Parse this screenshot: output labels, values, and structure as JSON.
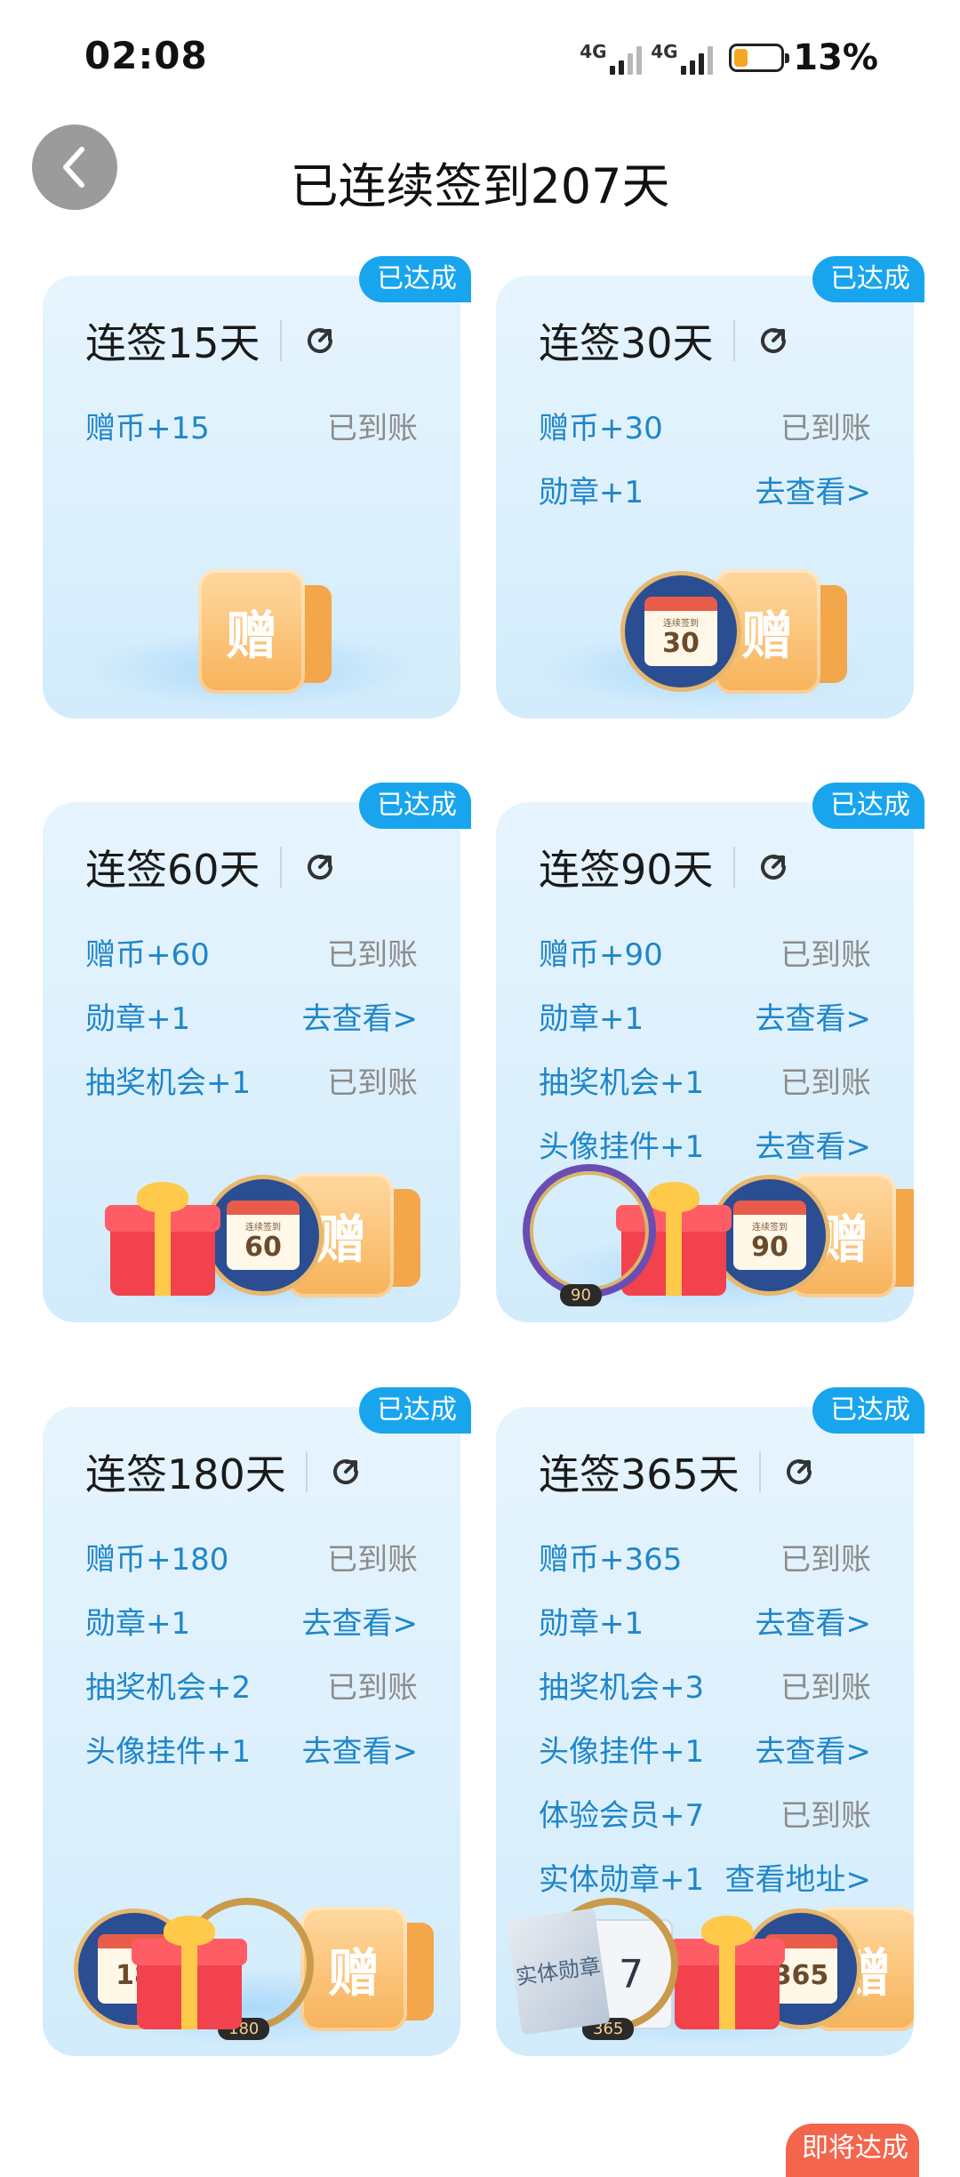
{
  "status_bar": {
    "time": "02:08",
    "signal1_label": "4G",
    "signal2_label": "4G",
    "battery_percent": "13%",
    "battery_level": 0.13
  },
  "header": {
    "title": "已连续签到207天"
  },
  "cards": [
    {
      "badge": "已达成",
      "title": "连签15天",
      "rows": [
        {
          "name": "赠币+15",
          "status": "已到账",
          "link": false
        }
      ]
    },
    {
      "badge": "已达成",
      "title": "连签30天",
      "rows": [
        {
          "name": "赠币+30",
          "status": "已到账",
          "link": false
        },
        {
          "name": "勋章+1",
          "status": "去查看>",
          "link": true
        }
      ],
      "medal_text": "连续签到",
      "medal_number": "30"
    },
    {
      "badge": "已达成",
      "title": "连签60天",
      "rows": [
        {
          "name": "赠币+60",
          "status": "已到账",
          "link": false
        },
        {
          "name": "勋章+1",
          "status": "去查看>",
          "link": true
        },
        {
          "name": "抽奖机会+1",
          "status": "已到账",
          "link": false
        }
      ],
      "medal_text": "连续签到",
      "medal_number": "60"
    },
    {
      "badge": "已达成",
      "title": "连签90天",
      "rows": [
        {
          "name": "赠币+90",
          "status": "已到账",
          "link": false
        },
        {
          "name": "勋章+1",
          "status": "去查看>",
          "link": true
        },
        {
          "name": "抽奖机会+1",
          "status": "已到账",
          "link": false
        },
        {
          "name": "头像挂件+1",
          "status": "去查看>",
          "link": true
        }
      ],
      "medal_text": "连续签到",
      "medal_number": "90",
      "ring_tag": "90"
    },
    {
      "badge": "已达成",
      "title": "连签180天",
      "rows": [
        {
          "name": "赠币+180",
          "status": "已到账",
          "link": false
        },
        {
          "name": "勋章+1",
          "status": "去查看>",
          "link": true
        },
        {
          "name": "抽奖机会+2",
          "status": "已到账",
          "link": false
        },
        {
          "name": "头像挂件+1",
          "status": "去查看>",
          "link": true
        }
      ],
      "medal_number": "18",
      "ring_tag": "180"
    },
    {
      "badge": "已达成",
      "title": "连签365天",
      "rows": [
        {
          "name": "赠币+365",
          "status": "已到账",
          "link": false
        },
        {
          "name": "勋章+1",
          "status": "去查看>",
          "link": true
        },
        {
          "name": "抽奖机会+3",
          "status": "已到账",
          "link": false
        },
        {
          "name": "头像挂件+1",
          "status": "去查看>",
          "link": true
        },
        {
          "name": "体验会员+7",
          "status": "已到账",
          "link": false
        },
        {
          "name": "实体勋章+1",
          "status": "查看地址>",
          "link": true
        }
      ],
      "book_text": "实体勋章",
      "card7_number": "7",
      "medal_number": "365",
      "ring_tag": "365"
    }
  ],
  "gift_glyph": "赠",
  "upcoming_badge": "即将达成",
  "colors": {
    "accent": "#18a5ee",
    "link": "#1f86c9",
    "muted": "#8c8c8c",
    "upcoming": "#f3654d"
  }
}
